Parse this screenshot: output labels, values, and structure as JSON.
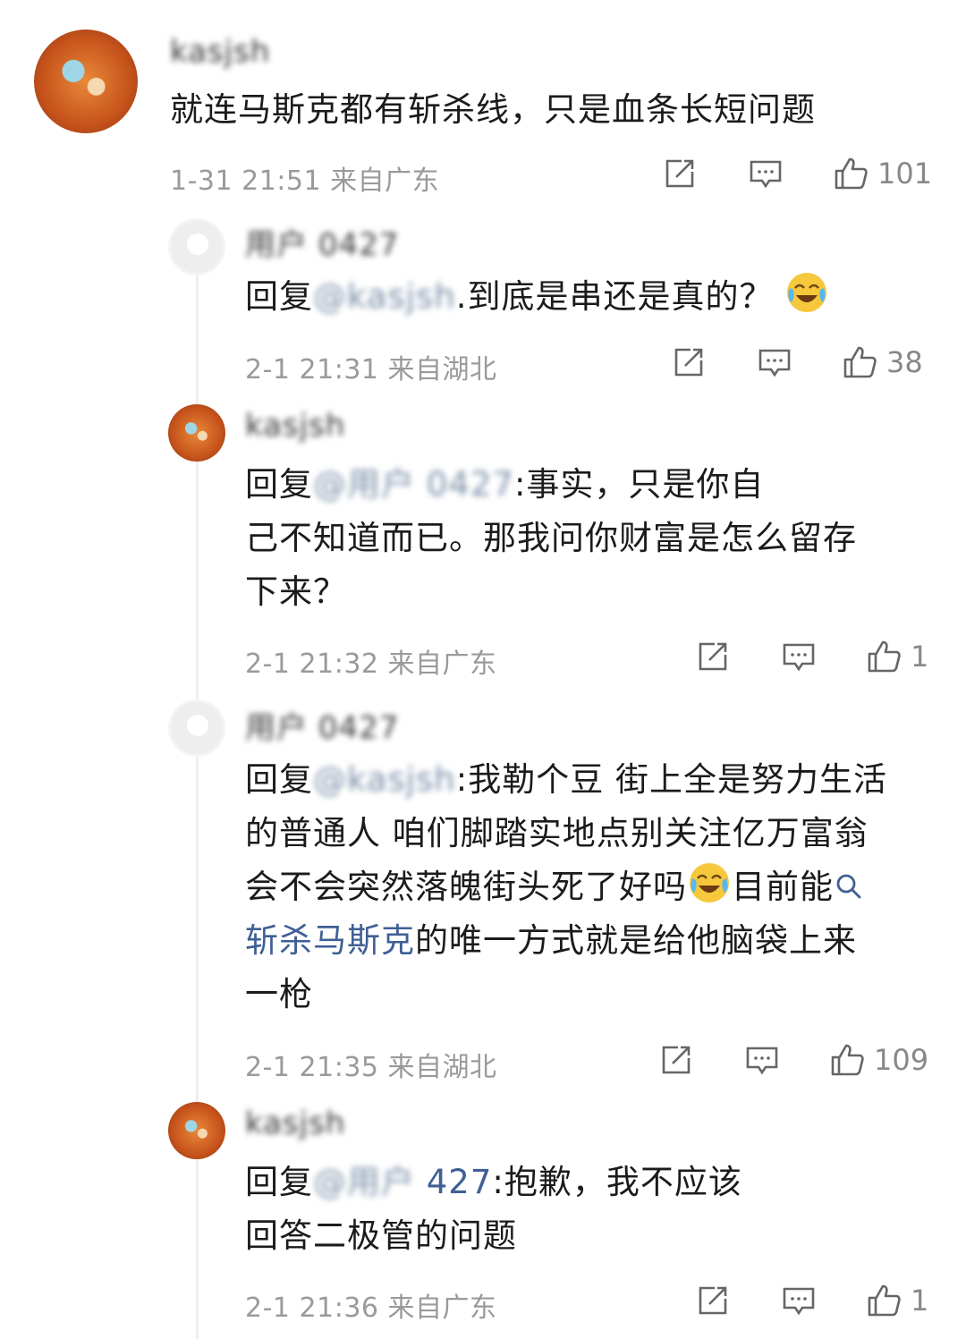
{
  "top_comment": {
    "username": "kasjsh",
    "text": "就连马斯克都有斩杀线，只是血条长短问题",
    "time": "1-31 21:51",
    "location": "来自广东",
    "likes": "101"
  },
  "replies": [
    {
      "username": "用户        0427",
      "prefix": "回复",
      "mention": "@kasjsh",
      "text": ".到底是串还是真的？",
      "time": "2-1 21:31",
      "location": "来自湖北",
      "likes": "38"
    },
    {
      "username": "kasjsh",
      "prefix": "回复",
      "mention": "@用户      0427",
      "text_line1": ":事实，只是你自",
      "text_line2": "己不知道而已。那我问你财富是怎么留存",
      "text_line3": "下来？",
      "time": "2-1 21:32",
      "location": "来自广东",
      "likes": "1"
    },
    {
      "username": "用户      0427",
      "prefix": "回复",
      "mention": "@kasjsh",
      "text_line1": ":我勒个豆 街上全是努力生活",
      "text_line2": "的普通人 咱们脚踏实地点别关注亿万富翁",
      "text_line3_a": "会不会突然落魄街头死了好吗",
      "text_line3_b": "目前能",
      "link_text": "斩杀马斯克",
      "text_line4": "的唯一方式就是给他脑袋上来",
      "text_line5": "一枪",
      "time": "2-1 21:35",
      "location": "来自湖北",
      "likes": "109"
    },
    {
      "username": "kasjsh",
      "prefix": "回复",
      "mention": "@用户      ",
      "mention_tail": "427",
      "text_line1": ":抱歉，我不应该",
      "text_line2": "回答二极管的问题",
      "time": "2-1 21:36",
      "location": "来自广东",
      "likes": "1"
    }
  ],
  "icons": {
    "repost": "repost-icon",
    "comment": "comment-icon",
    "like": "like-icon",
    "search": "search-icon",
    "emoji_cry_laugh": "cry-laugh-emoji",
    "emoji_joy": "joy-emoji"
  },
  "colors": {
    "link": "#3f5f95",
    "meta": "#9a9a9a",
    "text": "#1b1b1b"
  }
}
